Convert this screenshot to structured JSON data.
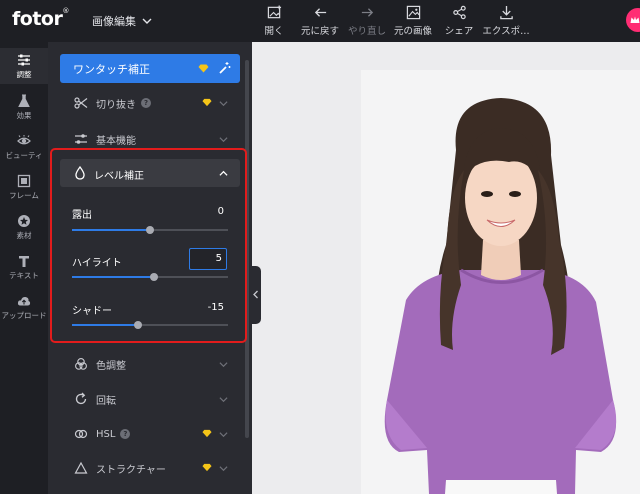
{
  "app": {
    "logo": "fotor",
    "logo_mark": "®",
    "mode_label": "画像編集"
  },
  "toolbar": {
    "open": "開く",
    "undo": "元に戻す",
    "redo": "やり直し",
    "original": "元の画像",
    "share": "シェア",
    "export": "エクスポ…"
  },
  "rail": {
    "adjust": "調整",
    "effects": "効果",
    "beauty": "ビューティ",
    "frames": "フレーム",
    "elements": "素材",
    "text": "テキスト",
    "upload": "アップロード"
  },
  "panel": {
    "one_touch": "ワンタッチ補正",
    "crop": "切り抜き",
    "basic": "基本機能",
    "levels": "レベル補正",
    "color": "色調整",
    "rotate": "回転",
    "hsl": "HSL",
    "structure": "ストラクチャー",
    "help_mark": "?"
  },
  "levels": {
    "exposure": {
      "label": "露出",
      "value": "0",
      "fraction": 0.5
    },
    "highlight": {
      "label": "ハイライト",
      "value": "5",
      "fraction": 0.525
    },
    "shadow": {
      "label": "シャドー",
      "value": "-15",
      "fraction": 0.425
    }
  },
  "colors": {
    "accent": "#2e7be6",
    "highlight_box": "#e21c1c",
    "panel_bg": "#2a2b31",
    "topbar_bg": "#1e1f24",
    "premium": "#f5c518",
    "brand_pink": "#ff2d74"
  },
  "icons": [
    "open-image-icon",
    "undo-arrow-icon",
    "redo-arrow-icon",
    "original-image-icon",
    "share-icon",
    "export-download-icon",
    "adjust-sliders-icon",
    "flask-icon",
    "eye-icon",
    "frame-icon",
    "star-badge-icon",
    "text-t-icon",
    "cloud-upload-icon",
    "scissors-icon",
    "sliders-icon",
    "droplet-icon",
    "color-circles-icon",
    "rotate-icon",
    "hsl-icon",
    "triangle-icon",
    "diamond-icon",
    "magic-wand-icon",
    "chevron-down-icon",
    "chevron-up-icon",
    "chevron-left-icon"
  ]
}
